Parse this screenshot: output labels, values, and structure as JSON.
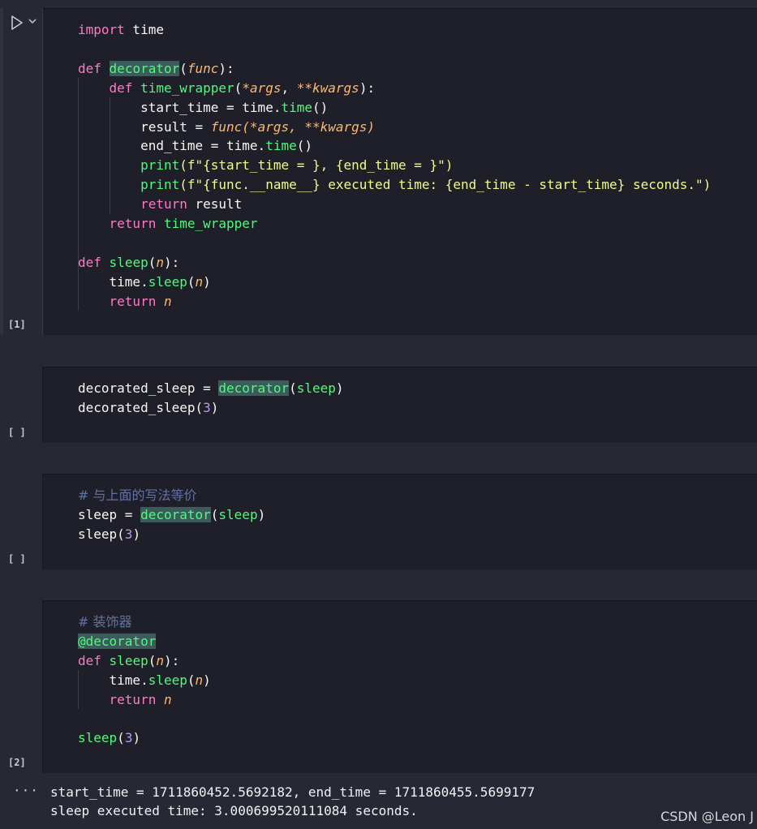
{
  "cells": [
    {
      "exec_count": "[1]"
    },
    {
      "exec_count": "[ ]"
    },
    {
      "exec_count": "[ ]"
    },
    {
      "exec_count": "[2]"
    }
  ],
  "cell1": {
    "l1_kw": "import",
    "l1_mod": " time",
    "l3_kw": "def",
    "l3_fn": "decorator",
    "l3_p": "func",
    "l4_kw": "def",
    "l4_fn": "time_wrapper",
    "l4_a": "*args",
    "l4_k": "**kwargs",
    "l5_a": "start_time = time.",
    "l5_f": "time",
    "l5_b": "()",
    "l6_a": "result = ",
    "l6_f": "func",
    "l6_b": "(*args, **kwargs)",
    "l7_a": "end_time = time.",
    "l7_f": "time",
    "l7_b": "()",
    "l8_print": "print",
    "l8_str": "(f\"{start_time = }, {end_time = }\")",
    "l9_print": "print",
    "l9_str": "(f\"{func.__name__} executed time: {end_time - start_time} seconds.\")",
    "l10_kw": "return",
    "l10_v": " result",
    "l11_kw": "return",
    "l11_v": " time_wrapper",
    "l13_kw": "def",
    "l13_fn": "sleep",
    "l13_p": "n",
    "l14_a": "time.",
    "l14_f": "sleep",
    "l14_p": "n",
    "l15_kw": "return",
    "l15_v": "n"
  },
  "cell2": {
    "l1_a": "decorated_sleep = ",
    "l1_f": "decorator",
    "l1_arg": "sleep",
    "l2_a": "decorated_sleep(",
    "l2_n": "3",
    "l2_b": ")"
  },
  "cell3": {
    "comment": "# 与上面的写法等价",
    "l2_a": "sleep = ",
    "l2_f": "decorator",
    "l2_arg": "sleep",
    "l3_a": "sleep(",
    "l3_n": "3",
    "l3_b": ")"
  },
  "cell4": {
    "comment": "# 装饰器",
    "deco": "@decorator",
    "l3_kw": "def",
    "l3_fn": "sleep",
    "l3_p": "n",
    "l4_a": "time.",
    "l4_f": "sleep",
    "l4_p": "n",
    "l5_kw": "return",
    "l5_v": "n",
    "l7_f": "sleep",
    "l7_n": "3"
  },
  "output": {
    "dots": "···",
    "line1": "start_time = 1711860452.5692182, end_time = 1711860455.5699177",
    "line2": "sleep executed time: 3.000699520111084 seconds."
  },
  "watermark": "CSDN @Leon J",
  "colors": {
    "keyword": "#ff79c6",
    "function": "#50fa7b",
    "param": "#ffb86c",
    "string": "#f1fa8c",
    "number": "#bd93f9",
    "comment": "#6272a4"
  }
}
